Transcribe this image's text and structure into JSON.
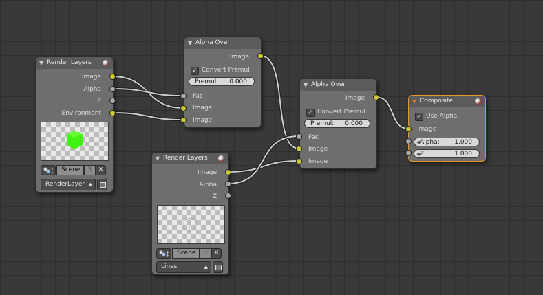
{
  "render_layers_1": {
    "title": "Render Layers",
    "outputs": [
      "Image",
      "Alpha",
      "Z",
      "Environment"
    ],
    "scene_label": "Scene",
    "scene_users": "3",
    "layer_value": "RenderLayer"
  },
  "render_layers_2": {
    "title": "Render Layers",
    "outputs": [
      "Image",
      "Alpha",
      "Z"
    ],
    "scene_label": "Scene",
    "scene_users": "3",
    "layer_value": "Lines"
  },
  "alpha_over_1": {
    "title": "Alpha Over",
    "output": "Image",
    "convert_premul_label": "Convert Premul",
    "convert_premul_checked": true,
    "premul_label": "Premul:",
    "premul_value": "0.000",
    "inputs": [
      "Fac",
      "Image",
      "Image"
    ]
  },
  "alpha_over_2": {
    "title": "Alpha Over",
    "output": "Image",
    "convert_premul_label": "Convert Premul",
    "convert_premul_checked": true,
    "premul_label": "Premul:",
    "premul_value": "0.000",
    "inputs": [
      "Fac",
      "Image",
      "Image"
    ]
  },
  "composite": {
    "title": "Composite",
    "use_alpha_label": "Use Alpha",
    "use_alpha_checked": true,
    "image_input": "Image",
    "alpha_label": "Alpha:",
    "alpha_value": "1.000",
    "z_label": "Z:",
    "z_value": "1.000"
  },
  "colors": {
    "background": "#393939",
    "node_body": "#6e6e6e",
    "socket_color": "#c8c832",
    "socket_value": "#a8a8a8",
    "active_outline": "#e8952c",
    "link": "#1e1e1e"
  }
}
